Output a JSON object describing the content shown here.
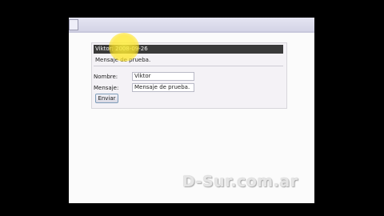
{
  "message": {
    "header": "Viktor: 2008-09-26",
    "body": "Mensaje de prueba."
  },
  "form": {
    "name_label": "Nombre:",
    "name_value": "Viktor",
    "message_label": "Mensaje:",
    "message_value": "Mensaje de prueba.",
    "send_label": "Enviar"
  },
  "watermark": "D-Sur.com.ar"
}
